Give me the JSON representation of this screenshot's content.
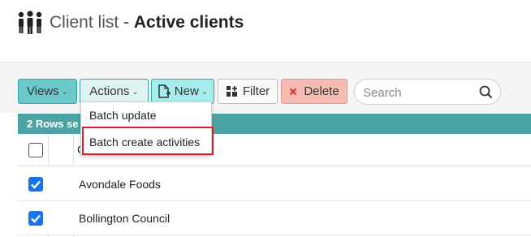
{
  "header": {
    "icon": "people-group-icon",
    "title": "Client list",
    "separator": " - ",
    "subtitle": "Active clients"
  },
  "toolbar": {
    "views_label": "Views",
    "actions_label": "Actions",
    "new_label": "New",
    "filter_label": "Filter",
    "delete_label": "Delete"
  },
  "search": {
    "placeholder": "Search",
    "value": ""
  },
  "actions_menu": {
    "items": [
      {
        "label": "Batch update"
      },
      {
        "label": "Batch create activities",
        "highlighted": true
      }
    ]
  },
  "table": {
    "selection_text": "2 Rows se",
    "header_cell_partial": "C",
    "rows": [
      {
        "name": "Avondale Foods",
        "checked": true
      },
      {
        "name": "Bollington Council",
        "checked": true
      }
    ]
  },
  "colors": {
    "accent_teal": "#4ba3a3",
    "views_button": "#6bc9c9",
    "new_button": "#a5ecec",
    "delete_button": "#f6bcb1",
    "checkbox_checked": "#1a73e8",
    "highlight_border": "#d3202c"
  }
}
